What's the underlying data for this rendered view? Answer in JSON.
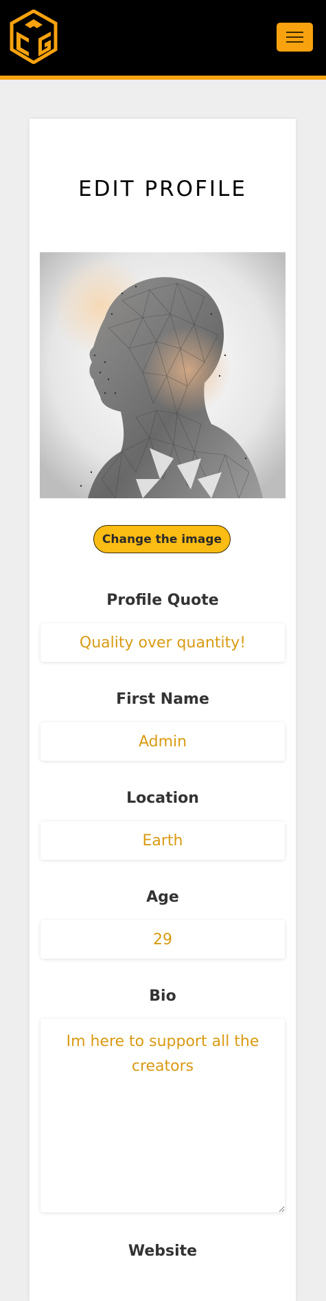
{
  "colors": {
    "accent": "#f7a20e",
    "button": "#fbbc13",
    "input_text": "#d99a12",
    "page_bg": "#efeeee"
  },
  "navbar": {
    "logo_icon": "cube-logo-icon",
    "menu_icon": "hamburger-icon"
  },
  "page": {
    "title": "EDIT PROFILE"
  },
  "profile_image": {
    "alt": "low-poly head silhouette"
  },
  "change_image_label": "Change the image",
  "fields": {
    "quote": {
      "label": "Profile Quote",
      "value": "Quality over quantity!"
    },
    "first": {
      "label": "First Name",
      "value": "Admin"
    },
    "location": {
      "label": "Location",
      "value": "Earth"
    },
    "age": {
      "label": "Age",
      "value": "29"
    },
    "bio": {
      "label": "Bio",
      "value": "Im here to support all the creators"
    },
    "website": {
      "label": "Website"
    }
  }
}
